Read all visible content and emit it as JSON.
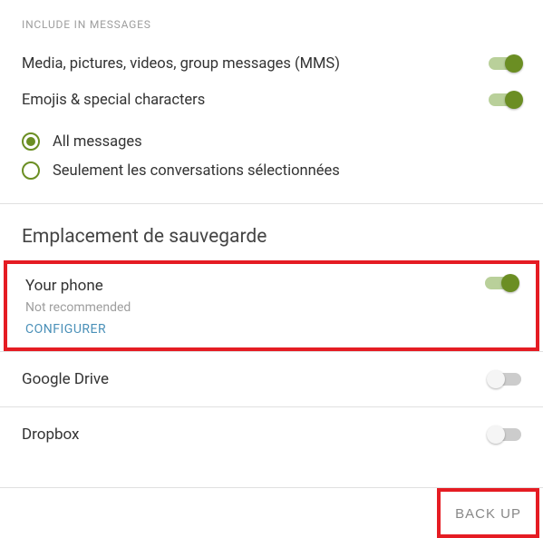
{
  "include": {
    "header": "INCLUDE IN MESSAGES",
    "mms_label": "Media, pictures, videos, group messages (MMS)",
    "emoji_label": "Emojis & special characters",
    "radio": {
      "all": "All messages",
      "selected": "Seulement les conversations sélectionnées"
    }
  },
  "location": {
    "header": "Emplacement de sauvegarde",
    "phone": {
      "title": "Your phone",
      "sub": "Not recommended",
      "config": "CONFIGURER"
    },
    "gdrive": "Google Drive",
    "dropbox": "Dropbox"
  },
  "footer": {
    "backup": "BACK UP"
  }
}
